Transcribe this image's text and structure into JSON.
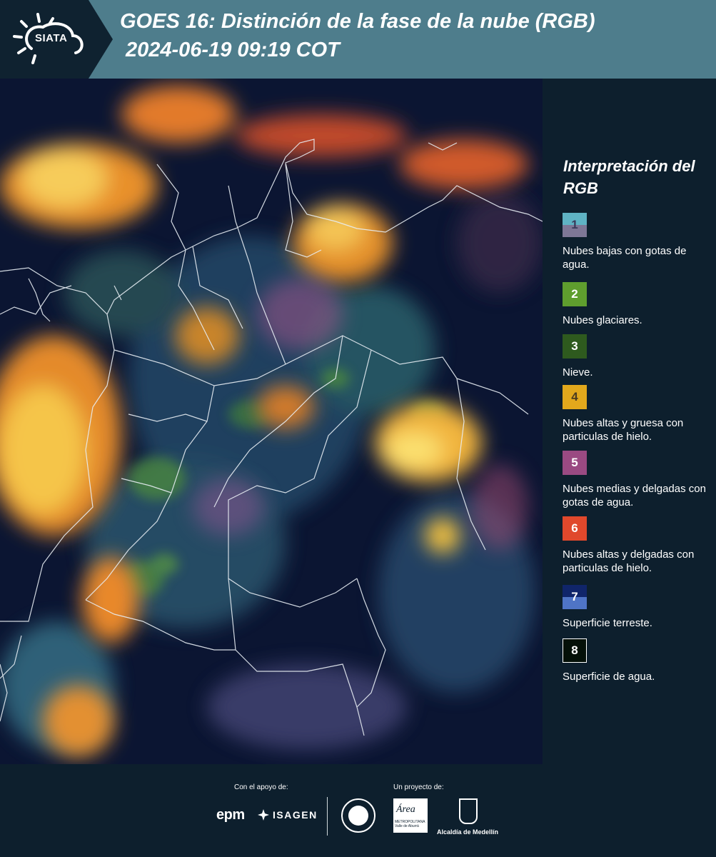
{
  "header": {
    "logo_text": "SIATA",
    "title_line1": "GOES 16: Distinción de la fase de la nube (RGB)",
    "title_line2": "2024-06-19 09:19 COT"
  },
  "legend": {
    "title": "Interpretación del RGB",
    "items": [
      {
        "number": "1",
        "label": "Nubes bajas con gotas de agua.",
        "color_top": "#5fb3c4",
        "color_bottom": "#7e7796"
      },
      {
        "number": "2",
        "label": "Nubes glaciares.",
        "color": "#5f9e2e"
      },
      {
        "number": "3",
        "label": "Nieve.",
        "color": "#2e5a1e"
      },
      {
        "number": "4",
        "label": "Nubes altas y gruesa con particulas de hielo.",
        "color": "#e2a81c"
      },
      {
        "number": "5",
        "label": "Nubes medias y delgadas con gotas de agua.",
        "color": "#9a4a82"
      },
      {
        "number": "6",
        "label": "Nubes altas y delgadas con particulas de hielo.",
        "color": "#e0482c"
      },
      {
        "number": "7",
        "label": "Superficie terreste.",
        "color_top": "#10256a",
        "color_bottom": "#4f74c6"
      },
      {
        "number": "8",
        "label": "Superficie de agua.",
        "color": "#041008"
      }
    ]
  },
  "footer": {
    "support_label": "Con el apoyo de:",
    "project_label": "Un proyecto de:",
    "sponsors": [
      "epm",
      "ISAGEN"
    ],
    "partners": [
      "Área Metropolitana Valle de Aburrá",
      "Alcaldía de Medellín"
    ],
    "alcaldia_label": "Alcaldía de Medellín",
    "area_logo_text": "Área",
    "area_logo_sub": "METROPOLITANA Valle de Aburrá"
  }
}
